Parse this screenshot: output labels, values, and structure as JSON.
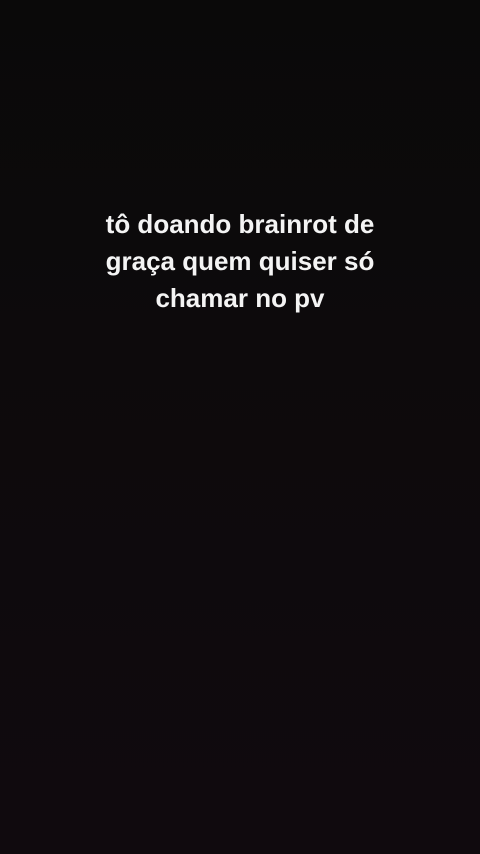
{
  "story": {
    "caption_lines": [
      "tô doando brainrot de",
      "graça quem quiser só",
      "chamar no pv"
    ]
  },
  "colors": {
    "background": "#0c090b",
    "text": "#f4f4f4"
  }
}
